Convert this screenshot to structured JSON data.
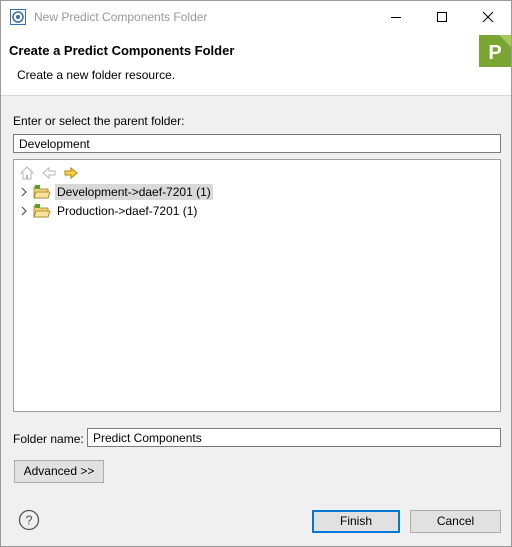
{
  "window": {
    "title": "New Predict Components Folder"
  },
  "header": {
    "title": "Create a Predict Components Folder",
    "description": "Create a new folder resource."
  },
  "parent_folder": {
    "label": "Enter or select the parent folder:",
    "value": "Development"
  },
  "toolbar": {
    "icons": [
      "home-icon",
      "back-icon",
      "forward-icon"
    ]
  },
  "tree": {
    "items": [
      {
        "label": "Development->daef-7201 (1)",
        "selected": true
      },
      {
        "label": "Production->daef-7201 (1)",
        "selected": false
      }
    ]
  },
  "folder_name": {
    "label": "Folder name:",
    "value": "Predict Components"
  },
  "buttons": {
    "advanced": "Advanced >>",
    "finish": "Finish",
    "cancel": "Cancel"
  },
  "banner": {
    "letter": "P"
  },
  "colors": {
    "accent": "#0078d7",
    "banner_green": "#7ba533",
    "forward_arrow": "#e0b814"
  }
}
